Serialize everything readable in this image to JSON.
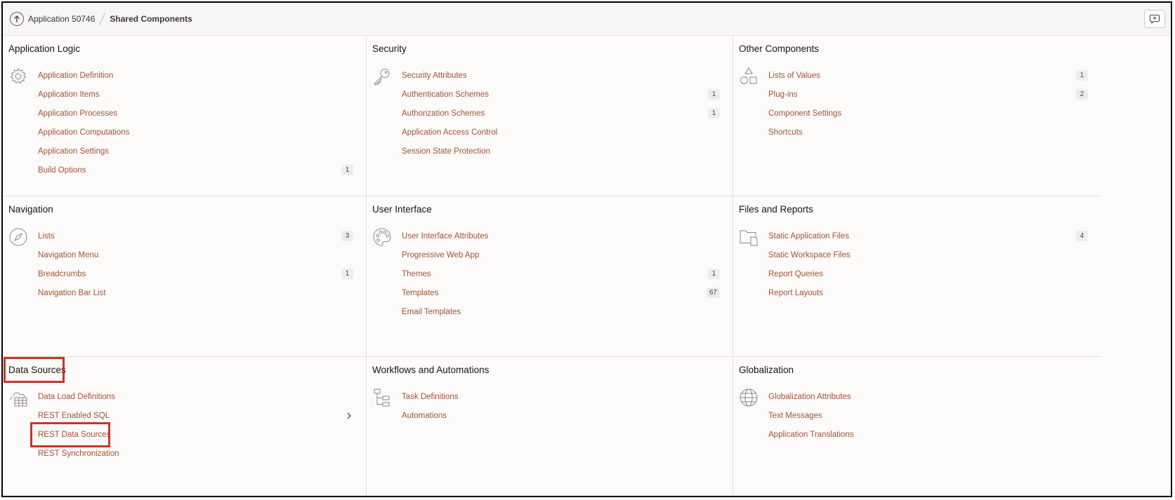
{
  "breadcrumb": {
    "parent": "Application 50746",
    "current": "Shared Components"
  },
  "sections": {
    "app_logic": {
      "title": "Application Logic",
      "icon": "gear-icon",
      "items": [
        {
          "label": "Application Definition"
        },
        {
          "label": "Application Items"
        },
        {
          "label": "Application Processes"
        },
        {
          "label": "Application Computations"
        },
        {
          "label": "Application Settings"
        },
        {
          "label": "Build Options",
          "count": "1"
        }
      ]
    },
    "security": {
      "title": "Security",
      "icon": "key-icon",
      "items": [
        {
          "label": "Security Attributes"
        },
        {
          "label": "Authentication Schemes",
          "count": "1"
        },
        {
          "label": "Authorization Schemes",
          "count": "1"
        },
        {
          "label": "Application Access Control"
        },
        {
          "label": "Session State Protection"
        }
      ]
    },
    "other": {
      "title": "Other Components",
      "icon": "shapes-icon",
      "items": [
        {
          "label": "Lists of Values",
          "count": "1"
        },
        {
          "label": "Plug-ins",
          "count": "2"
        },
        {
          "label": "Component Settings"
        },
        {
          "label": "Shortcuts"
        }
      ]
    },
    "navigation": {
      "title": "Navigation",
      "icon": "compass-icon",
      "items": [
        {
          "label": "Lists",
          "count": "3"
        },
        {
          "label": "Navigation Menu"
        },
        {
          "label": "Breadcrumbs",
          "count": "1"
        },
        {
          "label": "Navigation Bar List"
        }
      ]
    },
    "ui": {
      "title": "User Interface",
      "icon": "palette-icon",
      "items": [
        {
          "label": "User Interface Attributes"
        },
        {
          "label": "Progressive Web App"
        },
        {
          "label": "Themes",
          "count": "1"
        },
        {
          "label": "Templates",
          "count": "67"
        },
        {
          "label": "Email Templates"
        }
      ]
    },
    "files": {
      "title": "Files and Reports",
      "icon": "folder-icon",
      "items": [
        {
          "label": "Static Application Files",
          "count": "4"
        },
        {
          "label": "Static Workspace Files"
        },
        {
          "label": "Report Queries"
        },
        {
          "label": "Report Layouts"
        }
      ]
    },
    "data": {
      "title": "Data Sources",
      "icon": "cloud-table-icon",
      "items": [
        {
          "label": "Data Load Definitions"
        },
        {
          "label": "REST Enabled SQL"
        },
        {
          "label": "REST Data Sources"
        },
        {
          "label": "REST Synchronization"
        }
      ]
    },
    "workflows": {
      "title": "Workflows and Automations",
      "icon": "workflow-icon",
      "items": [
        {
          "label": "Task Definitions"
        },
        {
          "label": "Automations"
        }
      ]
    },
    "glob": {
      "title": "Globalization",
      "icon": "globe-icon",
      "items": [
        {
          "label": "Globalization Attributes"
        },
        {
          "label": "Text Messages"
        },
        {
          "label": "Application Translations"
        }
      ]
    }
  },
  "colors": {
    "link": "#a35134",
    "highlight": "#c0392b",
    "badge_bg": "#efedea"
  }
}
